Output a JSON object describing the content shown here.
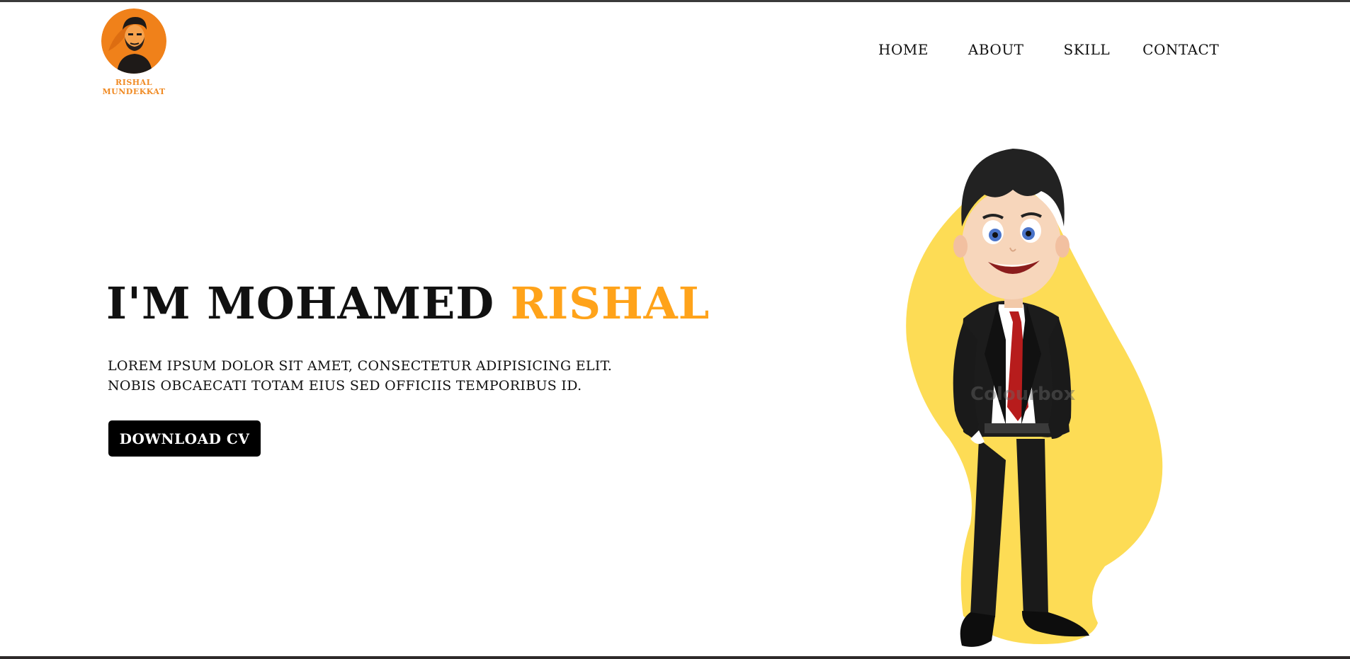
{
  "brand": {
    "name": "RISHAL MUNDEKKAT",
    "avatar_bg": "#f58a1f"
  },
  "nav": {
    "items": [
      {
        "label": "HOME"
      },
      {
        "label": "ABOUT"
      },
      {
        "label": "SKILL"
      },
      {
        "label": "CONTACT"
      }
    ]
  },
  "hero": {
    "title_main": "I'M MOHAMED",
    "title_accent": "RISHAL",
    "description_line1": "LOREM IPSUM DOLOR SIT AMET, CONSECTETUR ADIPISICING ELIT.",
    "description_line2": "NOBIS OBCAECATI TOTAM EIUS SED OFFICIIS TEMPORIBUS ID.",
    "cta_label": "DOWNLOAD CV",
    "accent_color": "#ffa31a"
  },
  "illustration": {
    "watermark": "Colourbox",
    "blob_color": "#fddc55"
  }
}
